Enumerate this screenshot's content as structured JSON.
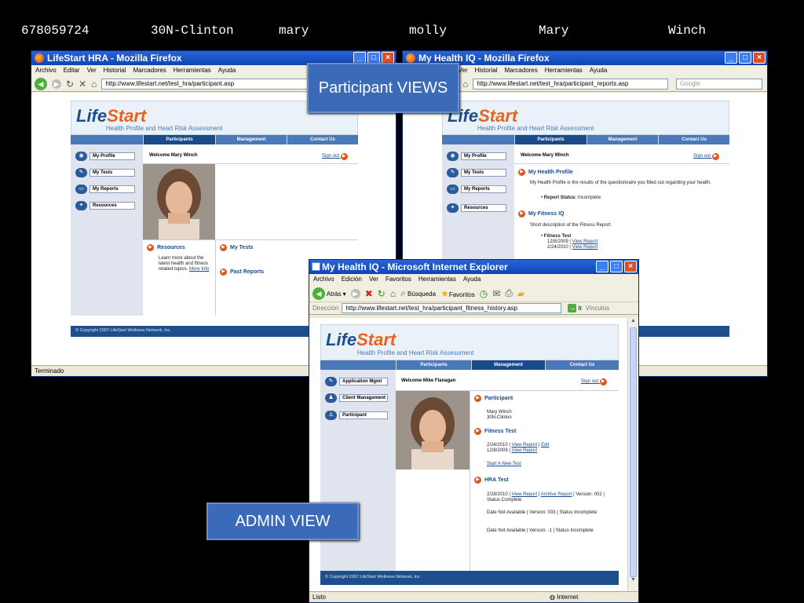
{
  "header": {
    "fields": [
      "678059724",
      "30N-Clinton",
      "mary",
      "molly",
      "Mary",
      "Winch"
    ]
  },
  "labels": {
    "participant": "Participant VIEWS",
    "admin": "ADMIN VIEW"
  },
  "firefox_menu": [
    "Archivo",
    "Editar",
    "Ver",
    "Historial",
    "Marcadores",
    "Herramientas",
    "Ayuda"
  ],
  "window1": {
    "title": "LifeStart HRA - Mozilla Firefox",
    "url": "http://www.lifestart.net/test_hra/participant.asp",
    "status": "Terminado"
  },
  "window2": {
    "title": "My Health IQ - Mozilla Firefox",
    "url": "http://www.lifestart.net/test_hra/participant_reports.asp",
    "search_placeholder": "Google"
  },
  "window3": {
    "title": "My Health IQ - Microsoft Internet Explorer",
    "menu": [
      "Archivo",
      "Edición",
      "Ver",
      "Favoritos",
      "Herramientas",
      "Ayuda"
    ],
    "toolbar": {
      "back": "Atrás",
      "search": "Búsqueda",
      "favorites": "Favoritos"
    },
    "address_label": "Dirección",
    "url": "http://www.lifestart.net/test_hra/participant_fitness_history.asp",
    "go": "Ir",
    "links": "Vínculos",
    "status_left": "Listo",
    "status_right": "Internet"
  },
  "site": {
    "logo_life": "Life",
    "logo_start": "Start",
    "tagline": "Health Profile and Heart Risk Assessment",
    "tabs": [
      "Participants",
      "Management",
      "Contact Us"
    ],
    "sign_out": "Sign out",
    "footer": "© Copyright 2007 LifeStart Wellness Network, Inc."
  },
  "participant_sidebar": [
    "My Profile",
    "My Tests",
    "My Reports",
    "Resources"
  ],
  "page1": {
    "welcome": "Welcome Mary Winch",
    "resources_title": "Resources",
    "resources_text": "Learn more about the latest health and fitness related topics.",
    "more_info": "More Info",
    "my_tests": "My Tests",
    "past_reports": "Past Reports"
  },
  "page2": {
    "welcome": "Welcome Mary Winch",
    "profile_title": "My Health Profile",
    "profile_text": "My Health Profile is the results of the questionnaire you filled out regarding your health.",
    "report_status_label": "Report Status:",
    "report_status_value": "Incomplete",
    "fitness_title": "My Fitness IQ",
    "fitness_text": "Short description of the Fitness Report.",
    "fitness_test_label": "Fitness Test",
    "fitness_rows": [
      {
        "date": "12/8/2009",
        "link": "View Report"
      },
      {
        "date": "2/24/2010",
        "link": "View Report"
      }
    ]
  },
  "admin_sidebar": [
    "Application Mgmt",
    "Client Management",
    "Participant"
  ],
  "page3": {
    "welcome": "Welcome Mike Flanagan",
    "participant_title": "Participant",
    "participant_name": "Mary Winch",
    "participant_org": "30N-Clinton",
    "fitness_title": "Fitness Test",
    "fitness_row1_date": "2/24/2010",
    "fitness_row1_view": "View Report",
    "fitness_row1_edit": "Edit",
    "fitness_row2_date": "12/8/2009",
    "fitness_row2_view": "View Report",
    "start_new": "Start A New Test",
    "hra_title": "HRA Test",
    "hra_row1_date": "2/28/2010",
    "hra_row1_view": "View Report",
    "hra_row1_archive": "Archive Report",
    "hra_row1_rest": "Version: 002 | Status Complete",
    "hra_row2": "Date Not Available | Version: 003 | Status Incomplete",
    "hra_row3": "Date Not Available | Version: -1 | Status Incomplete"
  }
}
